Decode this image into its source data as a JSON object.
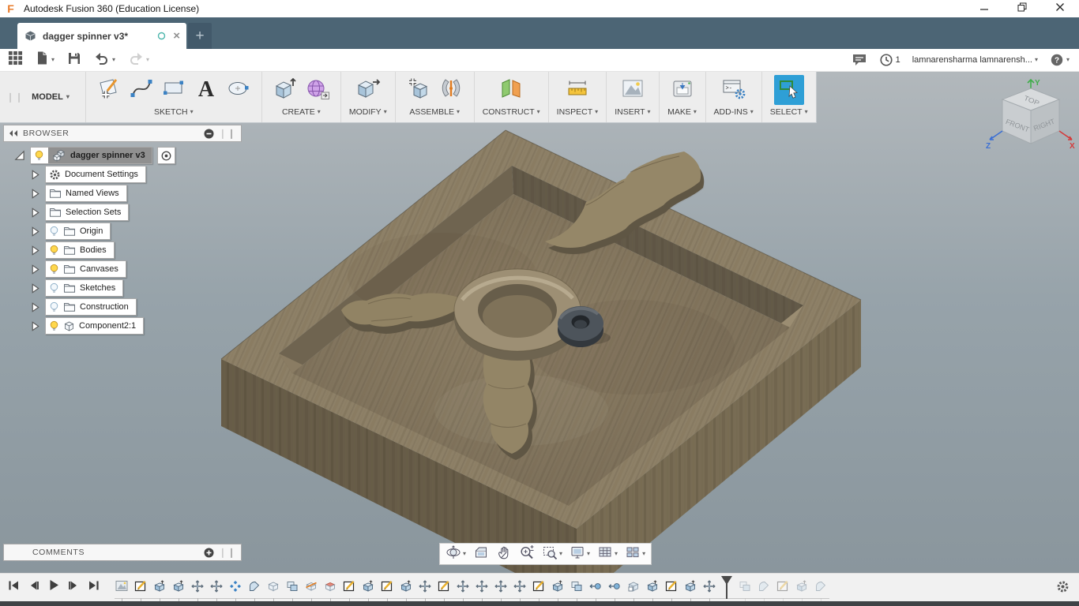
{
  "window": {
    "title": "Autodesk Fusion 360 (Education License)",
    "logo_letter": "F",
    "controls": [
      {
        "name": "minimize"
      },
      {
        "name": "restore"
      },
      {
        "name": "close"
      }
    ]
  },
  "tab_bar": {
    "active_tab_label": "dagger spinner v3*",
    "new_tab_label": "+"
  },
  "quick_toolbar": {
    "left_items": [
      {
        "name": "app-grid",
        "caret": false,
        "disabled": false
      },
      {
        "name": "file",
        "caret": true,
        "disabled": false
      },
      {
        "name": "save",
        "caret": false,
        "disabled": false
      },
      {
        "name": "undo",
        "caret": true,
        "disabled": false
      },
      {
        "name": "redo",
        "caret": true,
        "disabled": true
      }
    ],
    "notification_count": "1",
    "username": "lamnarensharma lamnarensh...",
    "help_label": "?"
  },
  "ribbon": {
    "workspace_label": "MODEL",
    "groups": [
      {
        "label": "SKETCH",
        "icons": [
          "create-sketch",
          "spline",
          "rectangle",
          "text",
          "ellipse"
        ],
        "active": false
      },
      {
        "label": "CREATE",
        "icons": [
          "extrude",
          "form"
        ],
        "active": false
      },
      {
        "label": "MODIFY",
        "icons": [
          "press-pull"
        ],
        "active": false
      },
      {
        "label": "ASSEMBLE",
        "icons": [
          "new-component",
          "joint"
        ],
        "active": false
      },
      {
        "label": "CONSTRUCT",
        "icons": [
          "construct-plane"
        ],
        "active": false
      },
      {
        "label": "INSPECT",
        "icons": [
          "measure"
        ],
        "active": false
      },
      {
        "label": "INSERT",
        "icons": [
          "insert-image"
        ],
        "active": false
      },
      {
        "label": "MAKE",
        "icons": [
          "print-3d"
        ],
        "active": false
      },
      {
        "label": "ADD-INS",
        "icons": [
          "add-ins"
        ],
        "active": false
      },
      {
        "label": "SELECT",
        "icons": [
          "select"
        ],
        "active": true
      }
    ]
  },
  "viewcube": {
    "top": "TOP",
    "front": "FRONT",
    "right": "RIGHT",
    "axis_x": "X",
    "axis_y": "Y",
    "axis_z": "Z"
  },
  "browser": {
    "header": "BROWSER",
    "items": [
      {
        "label": "dagger spinner v3",
        "icon": "assembly",
        "bulb": "on",
        "root": true
      },
      {
        "label": "Document Settings",
        "icon": "gear",
        "bulb": null
      },
      {
        "label": "Named Views",
        "icon": "folder",
        "bulb": null
      },
      {
        "label": "Selection Sets",
        "icon": "folder",
        "bulb": null
      },
      {
        "label": "Origin",
        "icon": "folder",
        "bulb": "off"
      },
      {
        "label": "Bodies",
        "icon": "folder",
        "bulb": "on"
      },
      {
        "label": "Canvases",
        "icon": "folder",
        "bulb": "on"
      },
      {
        "label": "Sketches",
        "icon": "folder",
        "bulb": "off"
      },
      {
        "label": "Construction",
        "icon": "folder",
        "bulb": "off"
      },
      {
        "label": "Component2:1",
        "icon": "component",
        "bulb": "on"
      }
    ]
  },
  "comments_panel": {
    "header": "COMMENTS"
  },
  "nav_bar": {
    "items": [
      {
        "name": "orbit",
        "caret": true
      },
      {
        "name": "look-at",
        "caret": false
      },
      {
        "name": "pan",
        "caret": false
      },
      {
        "name": "zoom",
        "caret": false
      },
      {
        "name": "zoom-window",
        "caret": true
      },
      {
        "name": "display-settings",
        "caret": true
      },
      {
        "name": "grid-settings",
        "caret": true
      },
      {
        "name": "viewports",
        "caret": true
      }
    ]
  },
  "timeline": {
    "playback": [
      "skip-start",
      "step-back",
      "play",
      "step-forward",
      "skip-end"
    ],
    "playhead_index": 32,
    "features": [
      {
        "type": "canvas",
        "enabled": true
      },
      {
        "type": "sketch",
        "enabled": true
      },
      {
        "type": "extrude",
        "enabled": true
      },
      {
        "type": "extrude",
        "enabled": true
      },
      {
        "type": "move",
        "enabled": true
      },
      {
        "type": "move",
        "enabled": true
      },
      {
        "type": "pattern",
        "enabled": true
      },
      {
        "type": "fillet",
        "enabled": true
      },
      {
        "type": "box",
        "enabled": true
      },
      {
        "type": "combine",
        "enabled": true
      },
      {
        "type": "split",
        "enabled": true
      },
      {
        "type": "surface",
        "enabled": true
      },
      {
        "type": "sketch",
        "enabled": true
      },
      {
        "type": "extrude",
        "enabled": true
      },
      {
        "type": "sketch",
        "enabled": true
      },
      {
        "type": "extrude",
        "enabled": true
      },
      {
        "type": "move",
        "enabled": true
      },
      {
        "type": "sketch",
        "enabled": true
      },
      {
        "type": "move",
        "enabled": true
      },
      {
        "type": "move",
        "enabled": true
      },
      {
        "type": "move",
        "enabled": true
      },
      {
        "type": "move",
        "enabled": true
      },
      {
        "type": "sketch",
        "enabled": true
      },
      {
        "type": "extrude",
        "enabled": true
      },
      {
        "type": "combine",
        "enabled": true
      },
      {
        "type": "joint",
        "enabled": true
      },
      {
        "type": "joint",
        "enabled": true
      },
      {
        "type": "component",
        "enabled": true
      },
      {
        "type": "extrude",
        "enabled": true
      },
      {
        "type": "sketch",
        "enabled": true
      },
      {
        "type": "extrude",
        "enabled": true
      },
      {
        "type": "move",
        "enabled": true
      },
      {
        "type": "combine",
        "enabled": false
      },
      {
        "type": "fillet",
        "enabled": false
      },
      {
        "type": "sketch",
        "enabled": false
      },
      {
        "type": "extrude",
        "enabled": false
      },
      {
        "type": "fillet",
        "enabled": false
      }
    ]
  },
  "colors": {
    "accent_blue": "#2e9fd6",
    "tab_bar": "#4c6575",
    "viewport_top": "#b2b8bc",
    "viewport_bottom": "#8a969d",
    "wood_light": "#8d8067",
    "wood_dark": "#655b47",
    "bearing_dark": "#33383d"
  }
}
